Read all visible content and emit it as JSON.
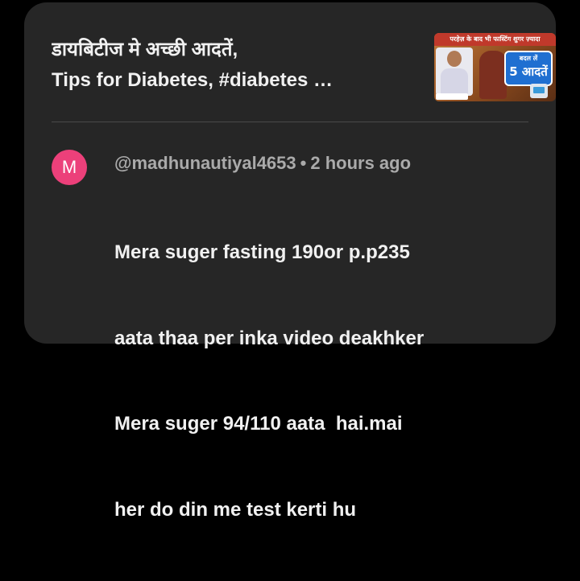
{
  "video": {
    "title_lines": [
      "डायबिटीज मे अच्छी आदतें,",
      "Tips for Diabetes, #diabetes …"
    ],
    "thumbnail": {
      "banner_text": "परहेज़ के बाद भी फास्टिंग शुगर ज़्यादा",
      "badge_small": "बदल लें",
      "badge_big": "5 आदतें",
      "accent_color": "#c0392b",
      "badge_color": "#1f6fd1"
    }
  },
  "comment": {
    "avatar_letter": "M",
    "avatar_color": "#ec407a",
    "author": "@madhunautiyal4653",
    "separator": "•",
    "timestamp": "2 hours ago",
    "text_lines": [
      "Mera suger fasting 190or p.p235",
      "aata thaa per inka video deakhker",
      "Mera suger 94/110 aata  hai.mai",
      "her do din me test kerti hu"
    ]
  }
}
